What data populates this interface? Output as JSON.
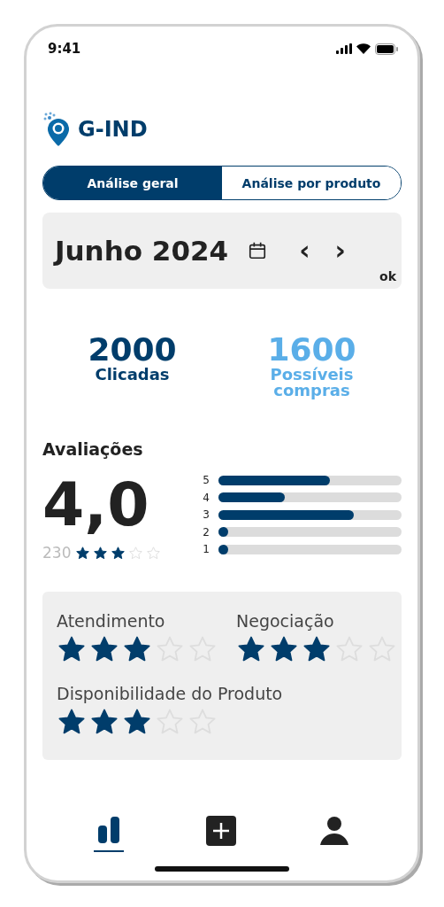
{
  "status_bar": {
    "time": "9:41"
  },
  "logo": {
    "text": "G-IND"
  },
  "tabs": [
    {
      "label": "Análise geral",
      "selected": true
    },
    {
      "label": "Análise por produto",
      "selected": false
    }
  ],
  "period": {
    "label": "Junho 2024",
    "prev": "‹",
    "next": "›",
    "confirm": "ok"
  },
  "stats": [
    {
      "value": "2000",
      "label": "Clicadas",
      "color": "#003d6b"
    },
    {
      "value": "1600",
      "label": "Possíveis compras",
      "color": "#5aaee8"
    }
  ],
  "reviews": {
    "title": "Avaliações",
    "score": "4,0",
    "count": "230",
    "stars": 3,
    "bars": [
      {
        "label": "5",
        "level": 0.61
      },
      {
        "label": "4",
        "level": 0.36
      },
      {
        "label": "3",
        "level": 0.74
      },
      {
        "label": "2",
        "level": 0.03
      },
      {
        "label": "1",
        "level": 0.03
      }
    ]
  },
  "criteria": [
    {
      "label": "Atendimento",
      "stars": 3
    },
    {
      "label": "Negociação",
      "stars": 3
    },
    {
      "label": "Disponibilidade do Produto",
      "stars": 3
    }
  ],
  "nav": [
    {
      "kind": "chart",
      "selected": true
    },
    {
      "kind": "add",
      "selected": false
    },
    {
      "kind": "profile",
      "selected": false
    }
  ]
}
